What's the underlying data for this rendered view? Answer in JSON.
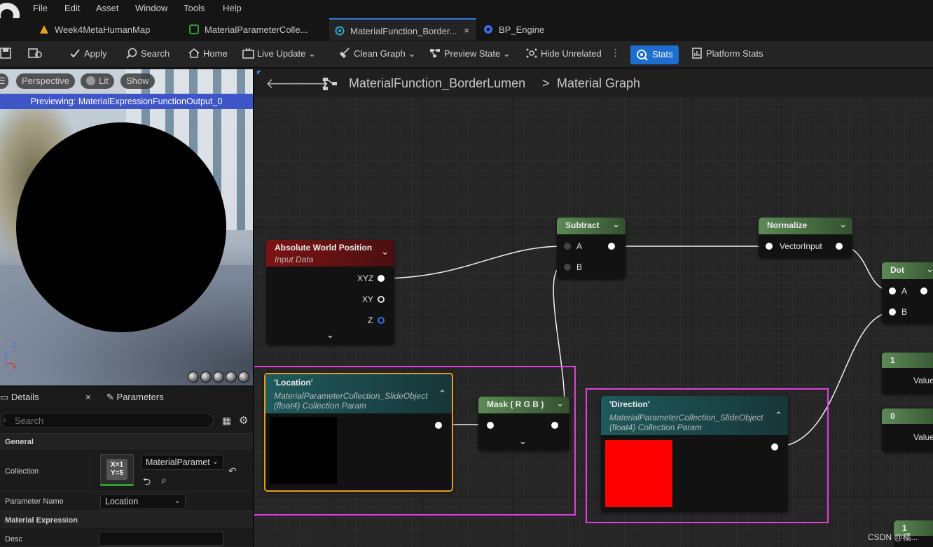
{
  "menu": [
    "File",
    "Edit",
    "Asset",
    "Window",
    "Tools",
    "Help"
  ],
  "tabs": [
    {
      "label": "Week4MetaHumanMap",
      "color": "#e8a020"
    },
    {
      "label": "MaterialParameterColle...",
      "color": "#2fa030"
    },
    {
      "label": "MaterialFunction_Border...",
      "color": "#30a8c8",
      "close": "×"
    },
    {
      "label": "BP_Engine",
      "color": "#3a6ef0"
    }
  ],
  "toolbar": {
    "apply": "Apply",
    "search": "Search",
    "home": "Home",
    "live_update": "Live Update",
    "clean_graph": "Clean Graph",
    "preview_state": "Preview State",
    "hide_unrelated": "Hide Unrelated",
    "stats": "Stats",
    "platform_stats": "Platform Stats"
  },
  "viewport": {
    "perspective": "Perspective",
    "lit": "Lit",
    "show": "Show",
    "previewing": "Previewing: MaterialExpressionFunctionOutput_0",
    "axis_z": "Z",
    "axis_x": "X"
  },
  "details": {
    "tab_details": "Details",
    "tab_close": "×",
    "tab_parameters": "Parameters",
    "search_placeholder": "Search",
    "section_general": "General",
    "collection_label": "Collection",
    "collection_thumb_line1": "X=1",
    "collection_thumb_line2": "Y=5",
    "collection_value": "MaterialParamet",
    "param_name_label": "Parameter Name",
    "param_name_value": "Location",
    "section_expression": "Material Expression",
    "desc_label": "Desc"
  },
  "graph": {
    "breadcrumb_function": "MaterialFunction_BorderLumen",
    "breadcrumb_sep": ">",
    "breadcrumb_graph": "Material Graph"
  },
  "nodes": {
    "abs_world": {
      "title": "Absolute World Position",
      "subtitle": "Input Data",
      "pins": [
        "XYZ",
        "XY",
        "Z"
      ]
    },
    "subtract": {
      "title": "Subtract",
      "pins": [
        "A",
        "B"
      ]
    },
    "normalize": {
      "title": "Normalize",
      "pins": [
        "VectorInput"
      ]
    },
    "dot": {
      "title": "Dot",
      "pins": [
        "A",
        "B"
      ]
    },
    "location": {
      "title": "'Location'",
      "subtitle1": "MaterialParameterCollection_SlideObject",
      "subtitle2": "(float4) Collection Param",
      "preview_color": "#000000"
    },
    "mask": {
      "title": "Mask ( R G B )"
    },
    "direction": {
      "title": "'Direction'",
      "subtitle1": "MaterialParameterCollection_SlideObject",
      "subtitle2": "(float4) Collection Param",
      "preview_color": "#ff0000"
    },
    "const1": {
      "title": "1",
      "value_label": "Value"
    },
    "const0": {
      "title": "0",
      "value_label": "Value"
    },
    "const1b": {
      "title": "1"
    }
  },
  "watermark": "CSDN @橘...",
  "colors": {
    "accent": "#1c6fd1",
    "highlight": "#e040e0",
    "selected": "#e8a020"
  }
}
